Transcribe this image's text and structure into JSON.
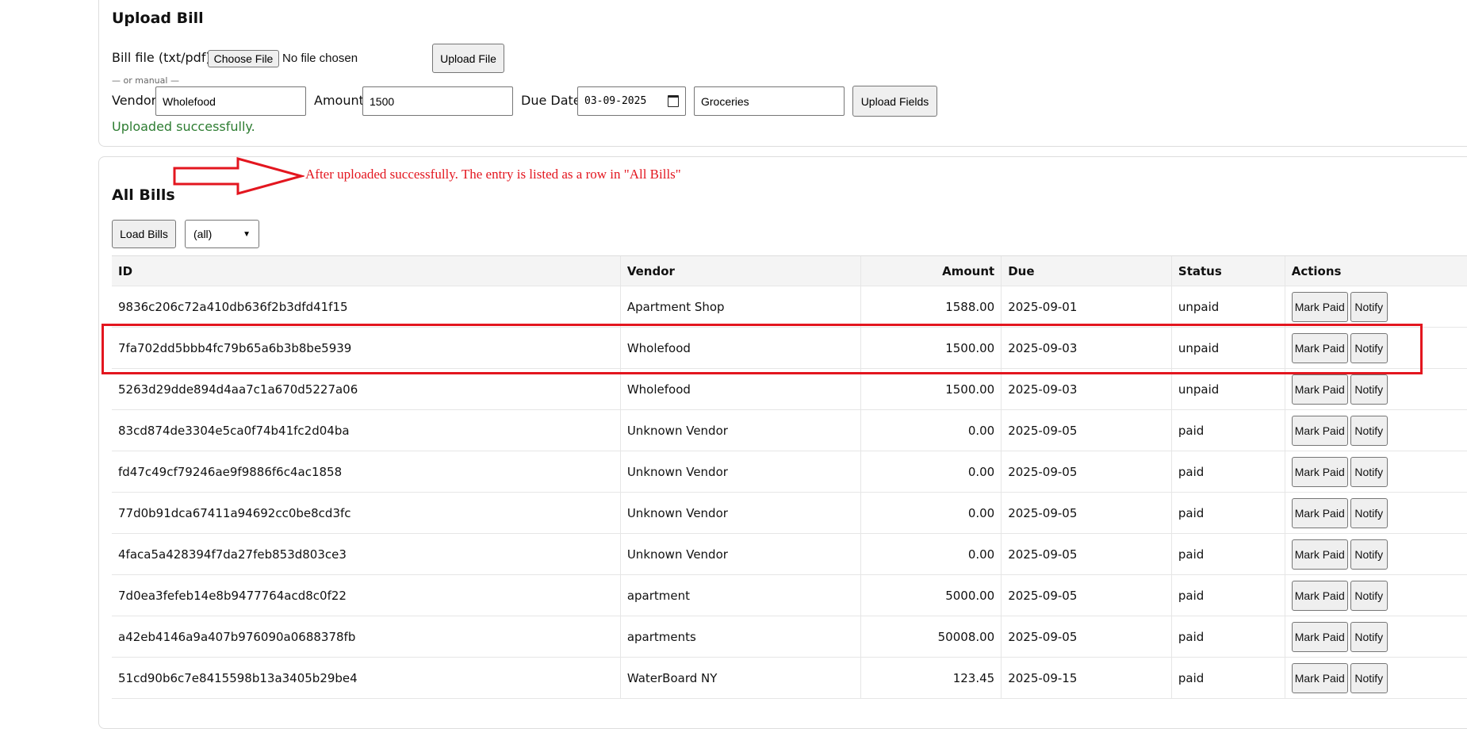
{
  "upload": {
    "title": "Upload Bill",
    "file_label": "Bill file (txt/pdf)",
    "choose_file_label": "Choose File",
    "no_file_text": "No file chosen",
    "upload_file_label": "Upload File",
    "or_manual": "— or manual —",
    "vendor_label": "Vendor",
    "vendor_value": "Wholefood",
    "amount_label": "Amount",
    "amount_value": "1500",
    "due_label": "Due Date",
    "due_value": "03-09-2025",
    "category_value": "Groceries",
    "upload_fields_label": "Upload Fields",
    "status_message": "Uploaded successfully."
  },
  "annotation": {
    "text": "After uploaded successfully. The entry is listed as a row in \"All Bills\"",
    "color": "#e3161f"
  },
  "bills": {
    "title": "All Bills",
    "load_label": "Load Bills",
    "filter_value": "(all)",
    "columns": [
      "ID",
      "Vendor",
      "Amount",
      "Due",
      "Status",
      "Actions"
    ],
    "mark_paid_label": "Mark Paid",
    "notify_label": "Notify",
    "rows": [
      {
        "id": "9836c206c72a410db636f2b3dfd41f15",
        "vendor": "Apartment Shop",
        "amount": "1588.00",
        "due": "2025-09-01",
        "status": "unpaid"
      },
      {
        "id": "7fa702dd5bbb4fc79b65a6b3b8be5939",
        "vendor": "Wholefood",
        "amount": "1500.00",
        "due": "2025-09-03",
        "status": "unpaid"
      },
      {
        "id": "5263d29dde894d4aa7c1a670d5227a06",
        "vendor": "Wholefood",
        "amount": "1500.00",
        "due": "2025-09-03",
        "status": "unpaid"
      },
      {
        "id": "83cd874de3304e5ca0f74b41fc2d04ba",
        "vendor": "Unknown Vendor",
        "amount": "0.00",
        "due": "2025-09-05",
        "status": "paid"
      },
      {
        "id": "fd47c49cf79246ae9f9886f6c4ac1858",
        "vendor": "Unknown Vendor",
        "amount": "0.00",
        "due": "2025-09-05",
        "status": "paid"
      },
      {
        "id": "77d0b91dca67411a94692cc0be8cd3fc",
        "vendor": "Unknown Vendor",
        "amount": "0.00",
        "due": "2025-09-05",
        "status": "paid"
      },
      {
        "id": "4faca5a428394f7da27feb853d803ce3",
        "vendor": "Unknown Vendor",
        "amount": "0.00",
        "due": "2025-09-05",
        "status": "paid"
      },
      {
        "id": "7d0ea3fefeb14e8b9477764acd8c0f22",
        "vendor": "apartment",
        "amount": "5000.00",
        "due": "2025-09-05",
        "status": "paid"
      },
      {
        "id": "a42eb4146a9a407b976090a0688378fb",
        "vendor": "apartments",
        "amount": "50008.00",
        "due": "2025-09-05",
        "status": "paid"
      },
      {
        "id": "51cd90b6c7e8415598b13a3405b29be4",
        "vendor": "WaterBoard NY",
        "amount": "123.45",
        "due": "2025-09-15",
        "status": "paid"
      }
    ]
  }
}
